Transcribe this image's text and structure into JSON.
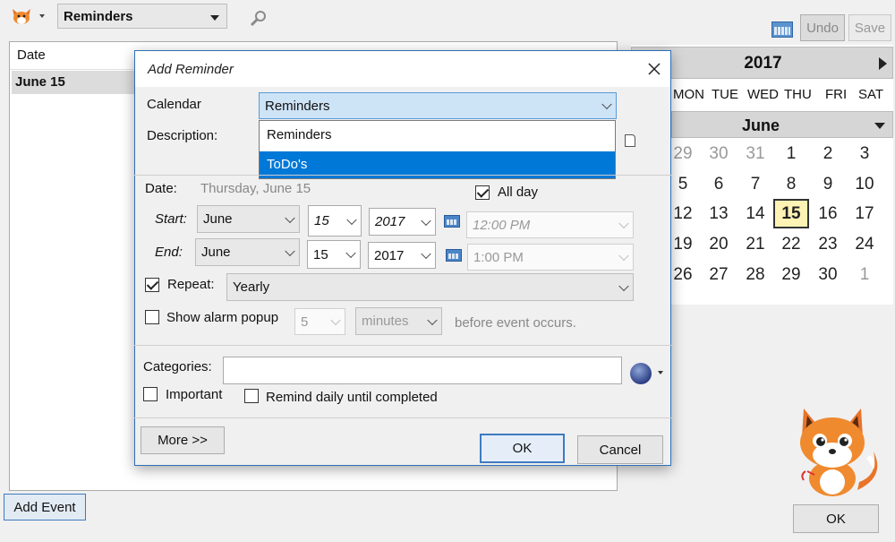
{
  "toolbar": {
    "calendar_selected": "Reminders",
    "undo_label": "Undo",
    "save_label": "Save"
  },
  "event_list": {
    "column_date": "Date",
    "rows": [
      {
        "date": "June 15"
      }
    ]
  },
  "add_event_label": "Add Event",
  "main_ok_label": "OK",
  "calendar": {
    "year": "2017",
    "month": "June",
    "weekdays": [
      "MON",
      "TUE",
      "WED",
      "THU",
      "FRI",
      "SAT"
    ],
    "weeks": [
      [
        "29",
        "30",
        "31",
        "1",
        "2",
        "3"
      ],
      [
        "5",
        "6",
        "7",
        "8",
        "9",
        "10"
      ],
      [
        "12",
        "13",
        "14",
        "15",
        "16",
        "17"
      ],
      [
        "19",
        "20",
        "21",
        "22",
        "23",
        "24"
      ],
      [
        "26",
        "27",
        "28",
        "29",
        "30",
        "1"
      ]
    ],
    "today": "15"
  },
  "dialog": {
    "title": "Add Reminder",
    "calendar_label": "Calendar",
    "calendar_value": "Reminders",
    "calendar_options": [
      "Reminders",
      "ToDo's"
    ],
    "description_label": "Description:",
    "date_label": "Date:",
    "date_value": "Thursday, June 15",
    "all_day_label": "All day",
    "start_label": "Start:",
    "end_label": "End:",
    "start": {
      "month": "June",
      "day": "15",
      "year": "2017",
      "time": "12:00 PM"
    },
    "end": {
      "month": "June",
      "day": "15",
      "year": "2017",
      "time": "1:00 PM"
    },
    "repeat_label": "Repeat:",
    "repeat_value": "Yearly",
    "alarm_label": "Show alarm popup",
    "alarm_amount": "5",
    "alarm_unit": "minutes",
    "alarm_suffix": "before event occurs.",
    "categories_label": "Categories:",
    "categories_value": "",
    "important_label": "Important",
    "remind_daily_label": "Remind daily until completed",
    "more_label": "More >>",
    "ok_label": "OK",
    "cancel_label": "Cancel"
  }
}
